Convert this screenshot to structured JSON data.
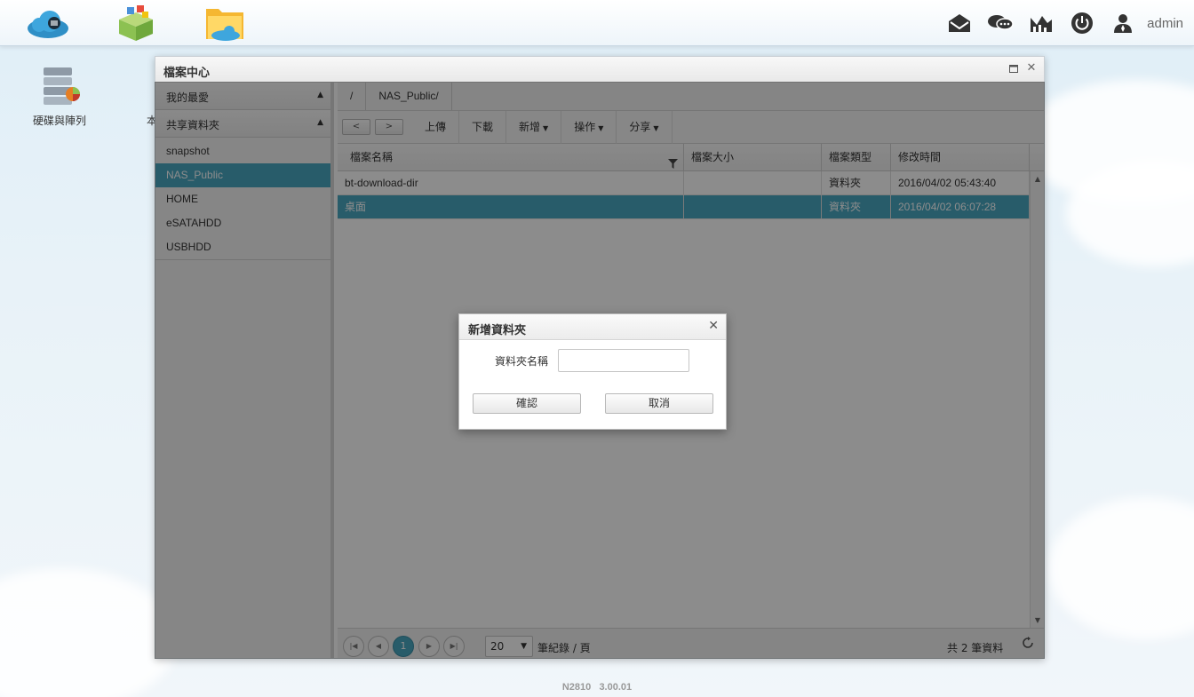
{
  "topbar": {
    "user": "admin"
  },
  "desktop": {
    "icons": [
      {
        "label": "硬碟與陣列"
      },
      {
        "label": "本"
      }
    ]
  },
  "window": {
    "title": "檔案中心",
    "sidebar": {
      "favorites_label": "我的最愛",
      "shared_label": "共享資料夾",
      "items": [
        "snapshot",
        "NAS_Public",
        "HOME",
        "eSATAHDD",
        "USBHDD"
      ],
      "selected_index": 1
    },
    "breadcrumb": [
      "/",
      "NAS_Public/"
    ],
    "toolbar": {
      "back": "<",
      "forward": ">",
      "upload": "上傳",
      "download": "下載",
      "new": "新增",
      "operate": "操作",
      "share": "分享"
    },
    "grid": {
      "columns": [
        "檔案名稱",
        "檔案大小",
        "檔案類型",
        "修改時間"
      ],
      "rows": [
        {
          "name": "bt-download-dir",
          "size": "",
          "type": "資料夾",
          "modified": "2016/04/02 05:43:40"
        },
        {
          "name": "桌面",
          "size": "",
          "type": "資料夾",
          "modified": "2016/04/02 06:07:28"
        }
      ]
    },
    "pager": {
      "current_page": "1",
      "page_size": "20",
      "per_page_label": "筆紀錄 / 頁",
      "total_label": "共 2 筆資料"
    }
  },
  "dialog": {
    "title": "新增資料夾",
    "field_label": "資料夾名稱",
    "field_value": "",
    "confirm": "確認",
    "cancel": "取消"
  },
  "footer": {
    "model": "N2810",
    "version": "3.00.01"
  }
}
